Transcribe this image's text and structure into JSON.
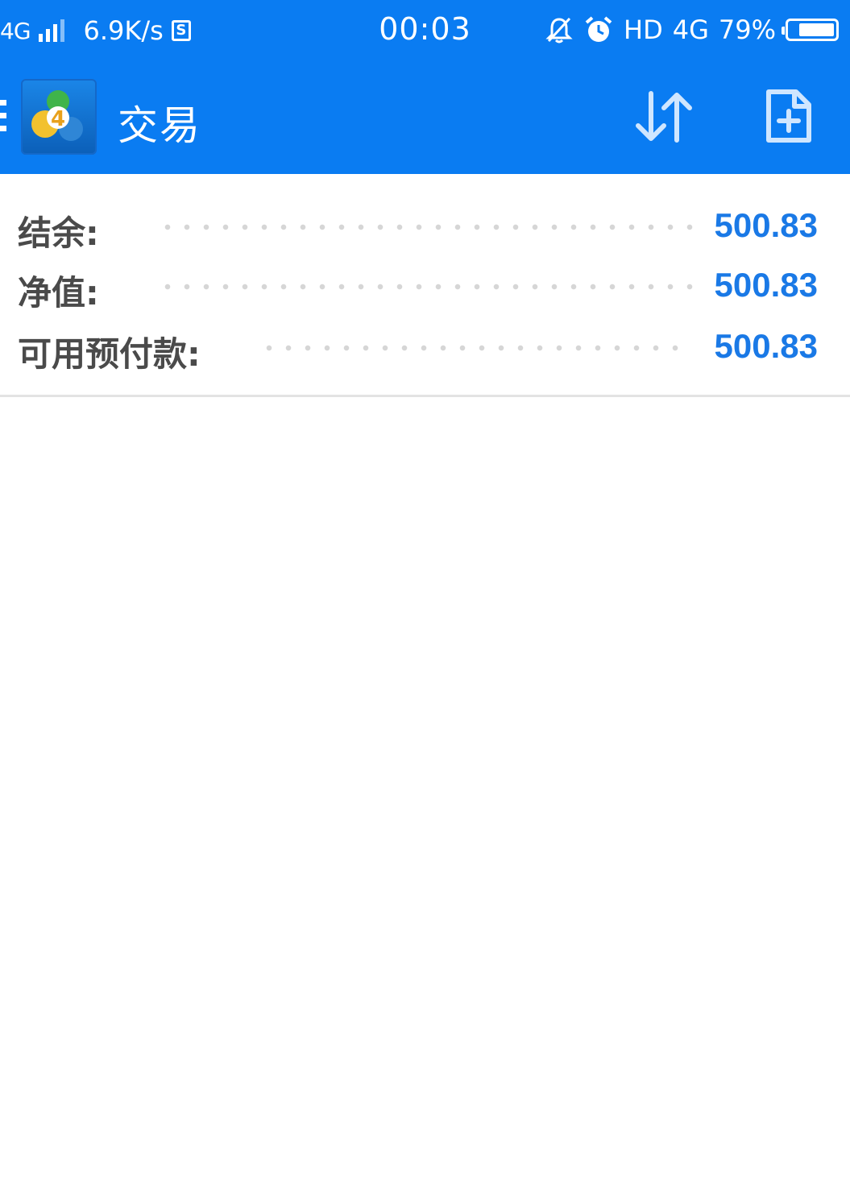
{
  "status_bar": {
    "network": "4G",
    "speed": "6.9K/s",
    "sim_icon_label": "S",
    "time": "00:03",
    "hd": "HD",
    "network_type": "4G",
    "battery": "79%",
    "icons": [
      "signal-icon",
      "sim-icon",
      "mute-icon",
      "alarm-icon",
      "battery-icon"
    ]
  },
  "app_bar": {
    "title": "交易",
    "logo_label": "4",
    "icons": [
      "menu-icon",
      "metatrader-logo",
      "sort-icon",
      "new-order-icon"
    ]
  },
  "account": {
    "rows": [
      {
        "label": "结余:",
        "value": "500.83"
      },
      {
        "label": "净值:",
        "value": "500.83"
      },
      {
        "label": "可用预付款:",
        "value": "500.83"
      }
    ]
  },
  "colors": {
    "primary": "#0A7CF2",
    "value_blue": "#1A79E6",
    "label_gray": "#4a4a4a"
  }
}
